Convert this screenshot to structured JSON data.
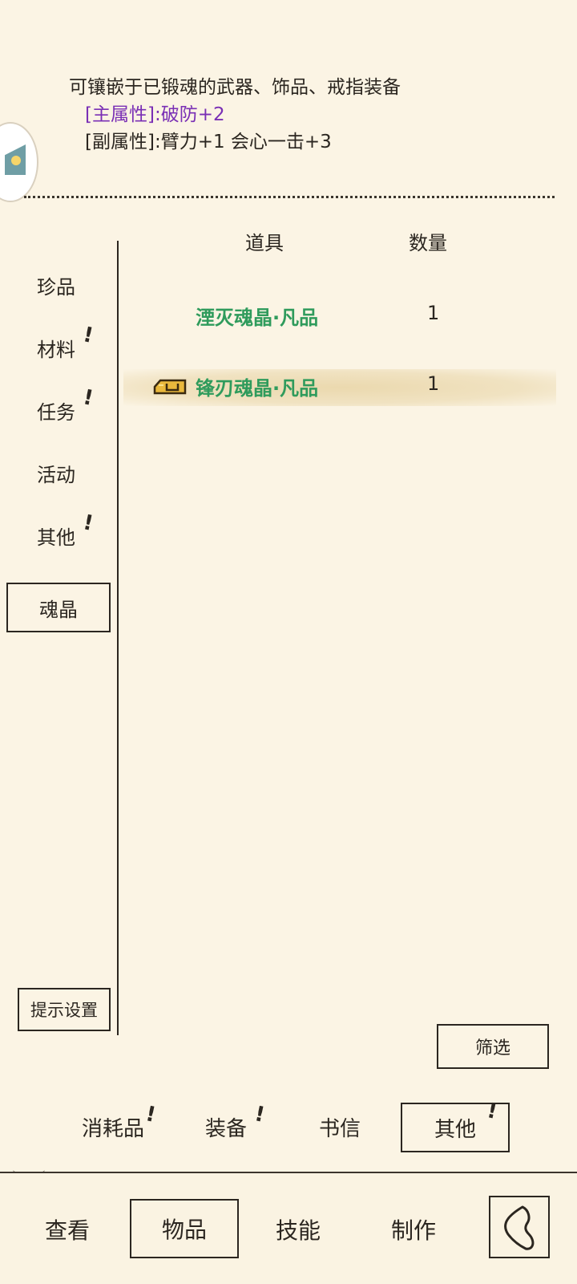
{
  "description": {
    "line1": "可镶嵌于已锻魂的武器、饰品、戒指装备",
    "main_attr": "[主属性]:破防+2",
    "sub_attr": "[副属性]:臂力+1 会心一击+3"
  },
  "table": {
    "col_item": "道具",
    "col_qty": "数量",
    "rows": [
      {
        "name": "湮灭魂晶·凡品",
        "qty": "1"
      },
      {
        "name": "锋刃魂晶·凡品",
        "qty": "1"
      }
    ]
  },
  "sidebar": {
    "items": [
      {
        "label": "珍品"
      },
      {
        "label": "材料",
        "alert": "!"
      },
      {
        "label": "任务",
        "alert": "!"
      },
      {
        "label": "活动"
      },
      {
        "label": "其他",
        "alert": "!"
      },
      {
        "label": "魂晶"
      }
    ],
    "hint_settings": "提示设置"
  },
  "filter_label": "筛选",
  "subtabs": [
    {
      "label": "消耗品",
      "alert": "!"
    },
    {
      "label": "装备",
      "alert": "!"
    },
    {
      "label": "书信"
    },
    {
      "label": "其他",
      "alert": "!"
    }
  ],
  "bottom_tabs": [
    {
      "label": "查看"
    },
    {
      "label": "物品"
    },
    {
      "label": "技能"
    },
    {
      "label": "制作"
    }
  ],
  "colors": {
    "background": "#fbf4e4",
    "item_name": "#2f9b5c",
    "main_attr": "#7a2fb5",
    "ink": "#2b2620"
  },
  "icons": {
    "side_badge": "app-badge-icon",
    "item": "soul-crystal-icon",
    "back": "back-arrow-icon"
  }
}
